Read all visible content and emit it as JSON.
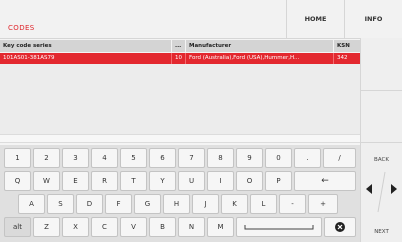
{
  "header": {
    "title": "CODES",
    "home_label": "HOME",
    "info_label": "INFO"
  },
  "table": {
    "columns": [
      "Key code series",
      "...",
      "Manufacturer",
      "KSN"
    ],
    "rows": [
      [
        "101AS01-381AS79",
        "10",
        "Ford (Australia),Ford (USA),Hummer,H...",
        "342"
      ]
    ]
  },
  "side": {
    "back_label": "BACK",
    "next_label": "NEXT",
    "left_arrow_icon": "triangle-left-icon",
    "right_arrow_icon": "triangle-right-icon"
  },
  "keyboard": {
    "row1": [
      "1",
      "2",
      "3",
      "4",
      "5",
      "6",
      "7",
      "8",
      "9",
      "0",
      ".",
      "/"
    ],
    "row2": [
      "Q",
      "W",
      "E",
      "R",
      "T",
      "Y",
      "U",
      "I",
      "O",
      "P",
      "←"
    ],
    "row3": [
      "A",
      "S",
      "D",
      "F",
      "G",
      "H",
      "J",
      "K",
      "L",
      "-",
      "+"
    ],
    "row4": [
      "alt",
      "Z",
      "X",
      "C",
      "V",
      "B",
      "N",
      "M"
    ],
    "space_icon": "spacebar-icon",
    "clear_icon": "clear-x-icon"
  },
  "colors": {
    "accent": "#e3282f"
  }
}
